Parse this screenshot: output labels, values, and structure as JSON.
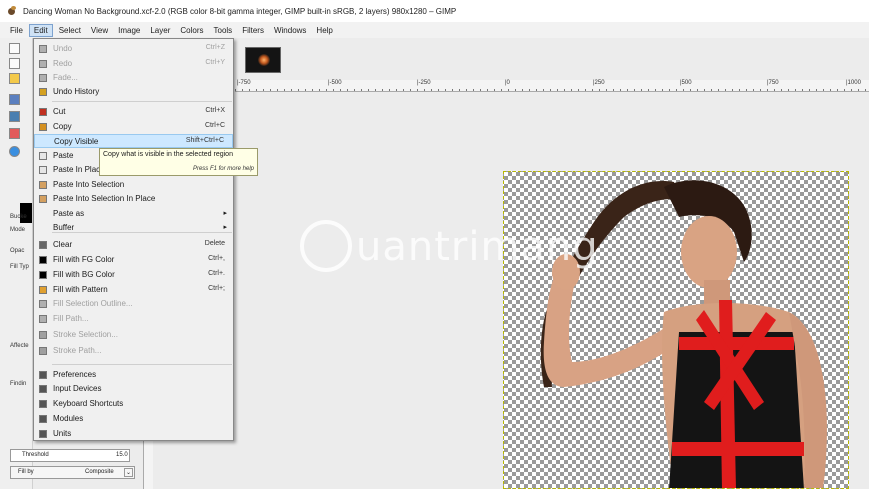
{
  "window": {
    "title": "Dancing Woman No Background.xcf-2.0 (RGB color 8-bit gamma integer, GIMP built-in sRGB, 2 layers) 980x1280 – GIMP"
  },
  "menubar": {
    "items": [
      "File",
      "Edit",
      "Select",
      "View",
      "Image",
      "Layer",
      "Colors",
      "Tools",
      "Filters",
      "Windows",
      "Help"
    ],
    "active": "Edit"
  },
  "edit_menu": {
    "items": [
      {
        "label": "Undo",
        "shortcut": "Ctrl+Z",
        "icon": "undo-icon",
        "disabled": true
      },
      {
        "label": "Redo",
        "shortcut": "Ctrl+Y",
        "icon": "redo-icon",
        "disabled": true
      },
      {
        "label": "Fade...",
        "shortcut": "",
        "icon": "fade-icon",
        "disabled": true
      },
      {
        "label": "Undo History",
        "shortcut": "",
        "icon": "history-icon",
        "disabled": false
      },
      {
        "label": "Cut",
        "shortcut": "Ctrl+X",
        "icon": "cut-icon",
        "disabled": false
      },
      {
        "label": "Copy",
        "shortcut": "Ctrl+C",
        "icon": "copy-icon",
        "disabled": false
      },
      {
        "label": "Copy Visible",
        "shortcut": "Shift+Ctrl+C",
        "icon": "",
        "disabled": false,
        "highlighted": true
      },
      {
        "label": "Paste",
        "shortcut": "",
        "icon": "paste-icon",
        "disabled": false
      },
      {
        "label": "Paste In Place",
        "shortcut": "",
        "icon": "paste-in-place-icon",
        "disabled": false
      },
      {
        "label": "Paste Into Selection",
        "shortcut": "",
        "icon": "paste-into-selection-icon",
        "disabled": false
      },
      {
        "label": "Paste Into Selection In Place",
        "shortcut": "",
        "icon": "paste-into-selection-in-place-icon",
        "disabled": false
      },
      {
        "label": "Paste as",
        "shortcut": "",
        "icon": "",
        "disabled": false,
        "submenu": true
      },
      {
        "label": "Buffer",
        "shortcut": "",
        "icon": "",
        "disabled": false,
        "submenu": true
      },
      {
        "label": "Clear",
        "shortcut": "Delete",
        "icon": "clear-icon",
        "disabled": false
      },
      {
        "label": "Fill with FG Color",
        "shortcut": "Ctrl+,",
        "icon": "fill-fg-icon",
        "disabled": false
      },
      {
        "label": "Fill with BG Color",
        "shortcut": "Ctrl+.",
        "icon": "fill-bg-icon",
        "disabled": false
      },
      {
        "label": "Fill with Pattern",
        "shortcut": "Ctrl+;",
        "icon": "fill-pattern-icon",
        "disabled": false
      },
      {
        "label": "Fill Selection Outline...",
        "shortcut": "",
        "icon": "fill-outline-icon",
        "disabled": true
      },
      {
        "label": "Fill Path...",
        "shortcut": "",
        "icon": "fill-path-icon",
        "disabled": true
      },
      {
        "label": "Stroke Selection...",
        "shortcut": "",
        "icon": "stroke-selection-icon",
        "disabled": true
      },
      {
        "label": "Stroke Path...",
        "shortcut": "",
        "icon": "stroke-path-icon",
        "disabled": true
      },
      {
        "label": "Preferences",
        "shortcut": "",
        "icon": "preferences-icon",
        "disabled": false
      },
      {
        "label": "Input Devices",
        "shortcut": "",
        "icon": "input-devices-icon",
        "disabled": false
      },
      {
        "label": "Keyboard Shortcuts",
        "shortcut": "",
        "icon": "keyboard-icon",
        "disabled": false
      },
      {
        "label": "Modules",
        "shortcut": "",
        "icon": "modules-icon",
        "disabled": false
      },
      {
        "label": "Units",
        "shortcut": "",
        "icon": "units-icon",
        "disabled": false
      }
    ]
  },
  "tooltip": {
    "text": "Copy what is visible in the selected region",
    "hint": "Press F1 for more help"
  },
  "rulers": {
    "labels": [
      "|-750",
      "|-500",
      "|-250",
      "|0",
      "|250",
      "|500",
      "|750",
      "|1000"
    ]
  },
  "toolbox": {
    "labels": [
      "Bucke",
      "Mode",
      "Opac",
      "Fill Typ",
      "Affecte",
      "Findin"
    ]
  },
  "tool_options": {
    "threshold_label": "Threshold",
    "threshold_value": "15.0",
    "fill_by_label": "Fill by",
    "fill_by_value": "Composite"
  },
  "watermark": {
    "text": "uantrimang"
  }
}
